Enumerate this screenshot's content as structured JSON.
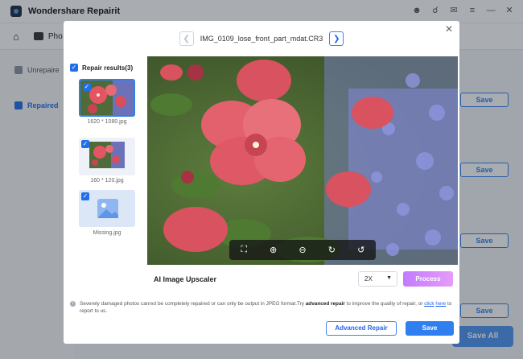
{
  "app": {
    "title": "Wondershare Repairit",
    "nav_photo_label": "Pho",
    "sidebar": {
      "unrepaired_label": "Unrepaire",
      "repaired_label": "Repaired"
    },
    "save_label": "Save",
    "save_all_label": "Save All"
  },
  "modal": {
    "filename": "IMG_0109_lose_front_part_mdat.CR3",
    "results_label": "Repair results(3)",
    "thumbnails": [
      {
        "label": "1620 * 1080.jpg",
        "selected": true
      },
      {
        "label": "160 * 120.jpg",
        "selected": false
      },
      {
        "label": "Missing.jpg",
        "selected": false
      }
    ],
    "upscaler": {
      "title": "AI Image Upscaler",
      "scale_value": "2X",
      "process_label": "Process"
    },
    "footnote": {
      "part1": "Severely damaged photos cannot be completely repaired or can only be output in JPEG format.Try ",
      "bold": "advanced repair",
      "part2": " to improve the quality of repair, or ",
      "link1": "click",
      "link2": "here",
      "part3": " to report to us."
    },
    "advanced_repair_label": "Advanced Repair",
    "save_label": "Save"
  },
  "colors": {
    "primary": "#2f7ff0",
    "process_gradient_start": "#c27bff",
    "process_gradient_end": "#e59cf7"
  }
}
